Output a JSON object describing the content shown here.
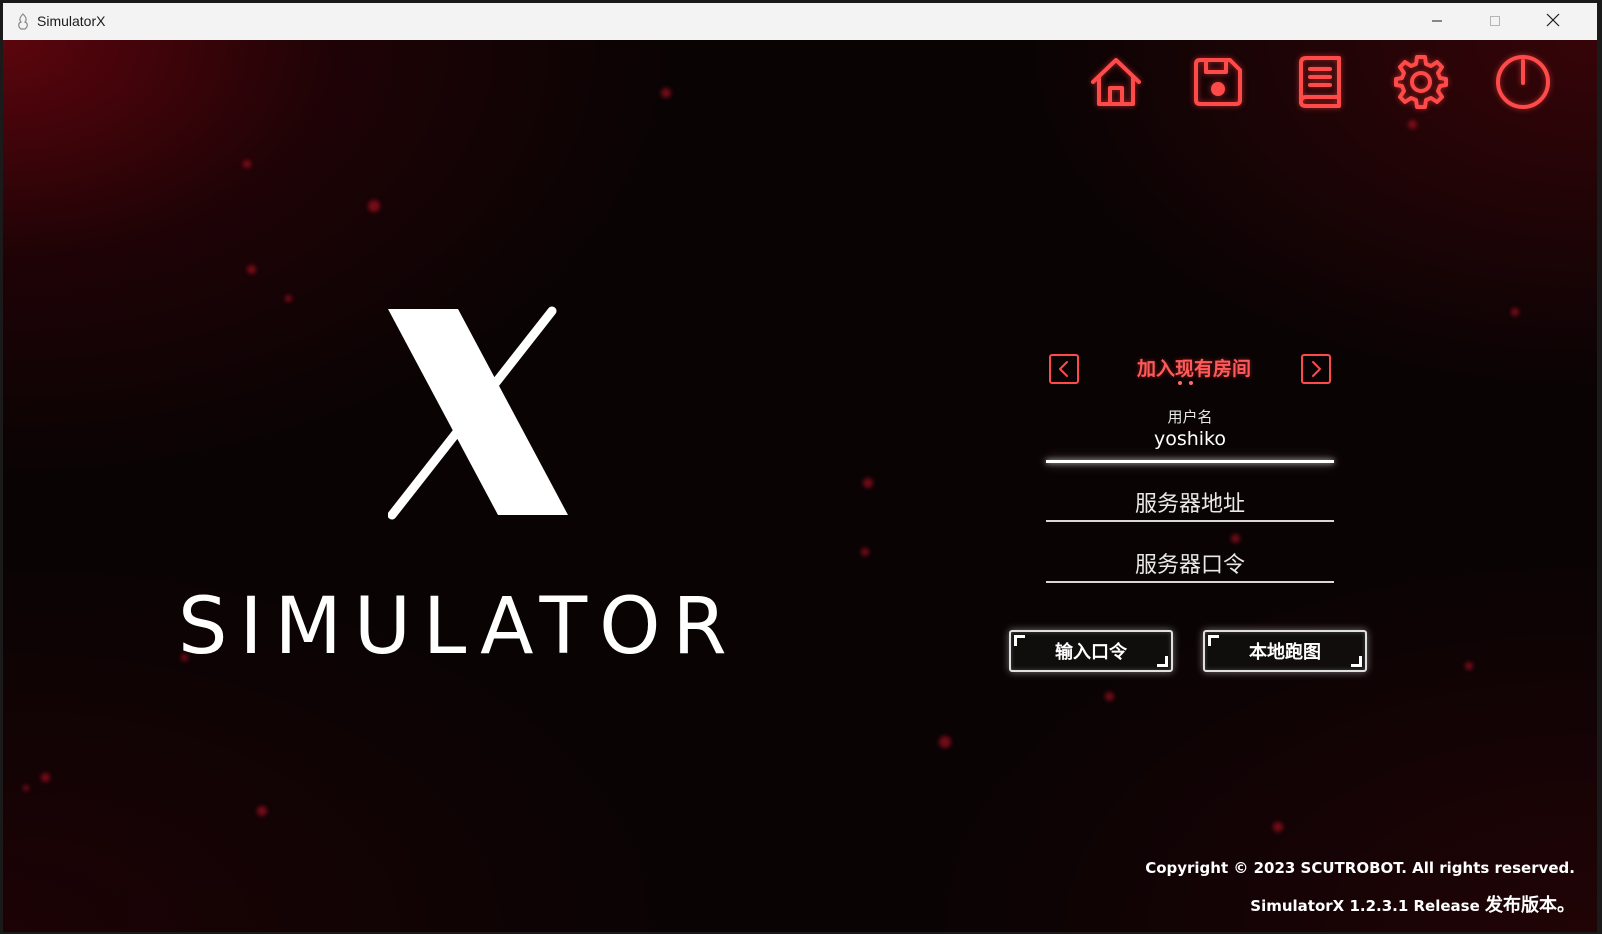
{
  "window": {
    "title": "SimulatorX",
    "controls": {
      "minimize": "minimize-icon",
      "maximize": "maximize-icon",
      "close": "close-icon"
    }
  },
  "toolbar": {
    "items": [
      {
        "name": "home",
        "icon": "home-icon"
      },
      {
        "name": "save",
        "icon": "save-icon"
      },
      {
        "name": "manual",
        "icon": "book-icon"
      },
      {
        "name": "settings",
        "icon": "gear-icon"
      },
      {
        "name": "power",
        "icon": "power-icon"
      }
    ],
    "accent_color": "#ff4a4a"
  },
  "logo": {
    "mark": "X",
    "text": "SIMULATOR"
  },
  "mode_selector": {
    "label": "加入现有房间",
    "prev_icon": "chevron-left-icon",
    "next_icon": "chevron-right-icon"
  },
  "form": {
    "username": {
      "label": "用户名",
      "value": "yoshiko"
    },
    "server_address": {
      "placeholder": "服务器地址"
    },
    "server_password": {
      "placeholder": "服务器口令"
    }
  },
  "buttons": {
    "enter_password": "输入口令",
    "local_map": "本地跑图"
  },
  "footer": {
    "copyright": "Copyright © 2023 SCUTROBOT. All rights reserved.",
    "version_prefix": "SimulatorX 1.2.3.1 Release ",
    "version_suffix": "发布版本。"
  },
  "colors": {
    "accent": "#ff4a4a",
    "background": "#0a0304",
    "text": "#ffffff"
  }
}
